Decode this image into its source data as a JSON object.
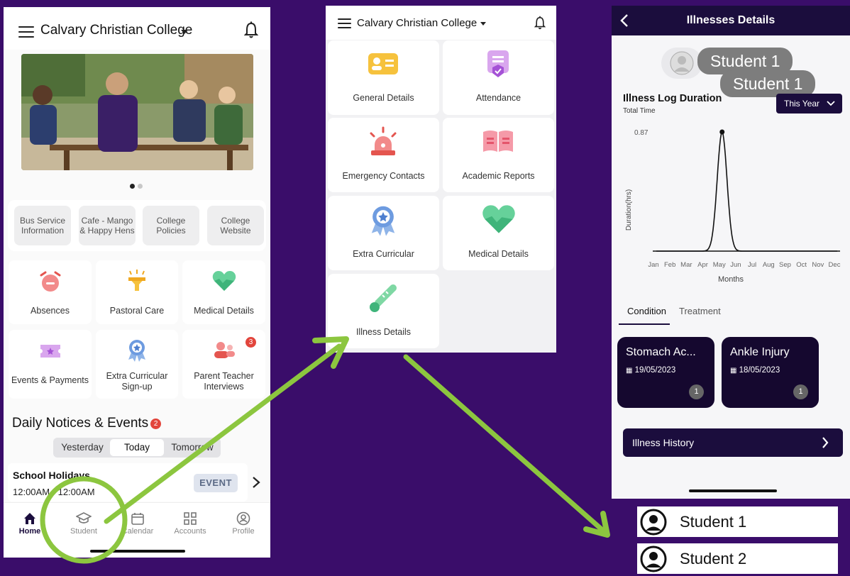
{
  "phone1": {
    "app_title": "Calvary Christian College",
    "quick_links": [
      "Bus Service Information",
      "Cafe - Mango & Happy Hens",
      "College Policies",
      "College Website"
    ],
    "tiles": [
      {
        "label": "Absences",
        "icon": "alarm-clock-icon"
      },
      {
        "label": "Pastoral Care",
        "icon": "funnel-icon"
      },
      {
        "label": "Medical Details",
        "icon": "heart-icon"
      },
      {
        "label": "Events & Payments",
        "icon": "ticket-icon"
      },
      {
        "label": "Extra Curricular Sign-up",
        "icon": "award-icon"
      },
      {
        "label": "Parent Teacher Interviews",
        "icon": "people-icon",
        "badge": "3"
      }
    ],
    "notices_title": "Daily Notices & Events",
    "notices_badge": "2",
    "segments": [
      "Yesterday",
      "Today",
      "Tomorrow"
    ],
    "notice": {
      "title": "School Holidays",
      "time": "12:00AM - 12:00AM",
      "badge": "EVENT"
    },
    "tabs": [
      {
        "label": "Home",
        "icon": "home-icon"
      },
      {
        "label": "Student",
        "icon": "graduation-cap-icon"
      },
      {
        "label": "Calendar",
        "icon": "calendar-icon"
      },
      {
        "label": "Accounts",
        "icon": "grid-icon"
      },
      {
        "label": "Profile",
        "icon": "profile-icon"
      }
    ]
  },
  "phone2": {
    "app_title": "Calvary Christian College",
    "items": [
      {
        "label": "General Details",
        "icon": "id-card-icon"
      },
      {
        "label": "Attendance",
        "icon": "clipboard-check-icon"
      },
      {
        "label": "Emergency Contacts",
        "icon": "siren-icon"
      },
      {
        "label": "Academic Reports",
        "icon": "book-icon"
      },
      {
        "label": "Extra Curricular",
        "icon": "award-icon"
      },
      {
        "label": "Medical Details",
        "icon": "heart-icon"
      },
      {
        "label": "Illness Details",
        "icon": "thermometer-icon"
      }
    ]
  },
  "phone3": {
    "header_title": "Illnesses Details",
    "student_pill_1": "Student 1",
    "student_pill_2": "Student 1",
    "chart_title": "Illness Log Duration",
    "chart_subtitle": "Total Time",
    "period": "This Year",
    "tabs": [
      "Condition",
      "Treatment"
    ],
    "conditions": [
      {
        "name": "Stomach Ac...",
        "date": "19/05/2023",
        "count": "1"
      },
      {
        "name": "Ankle Injury",
        "date": "18/05/2023",
        "count": "1"
      }
    ],
    "history_label": "Illness History"
  },
  "chart_data": {
    "type": "line",
    "title": "Illness Log Duration",
    "subtitle": "Total Time",
    "xlabel": "Months",
    "ylabel": "Duration(hrs)",
    "categories": [
      "Jan",
      "Feb",
      "Mar",
      "Apr",
      "May",
      "Jun",
      "Jul",
      "Aug",
      "Sep",
      "Oct",
      "Nov",
      "Dec"
    ],
    "values": [
      0,
      0,
      0,
      0,
      0.87,
      0,
      0,
      0,
      0,
      0,
      0,
      0
    ],
    "peak_label": "0.87",
    "grid": false
  },
  "students": [
    "Student 1",
    "Student 2"
  ],
  "colors": {
    "background": "#3a0d6a",
    "arrow": "#8cc63f",
    "header_dark": "#1b0d3d",
    "badge_red": "#e2453c"
  }
}
